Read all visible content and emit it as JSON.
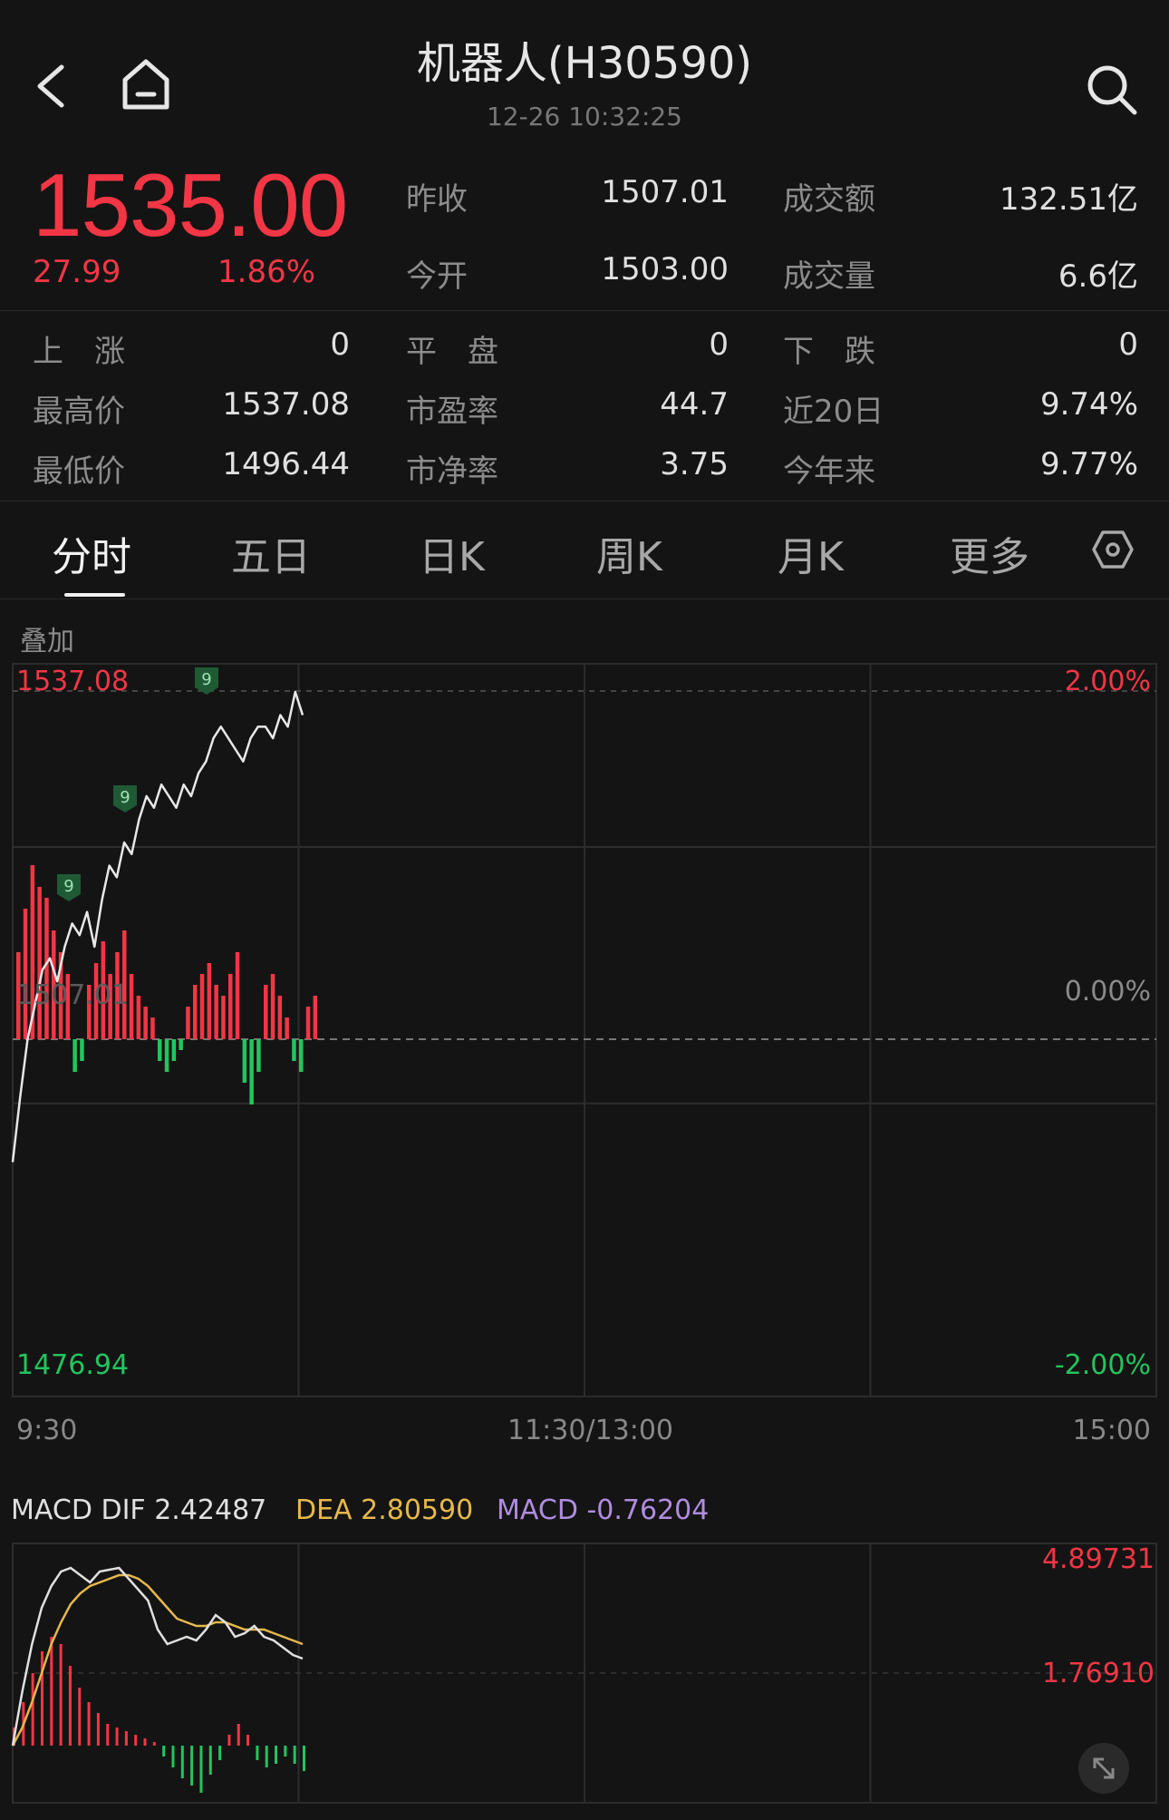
{
  "header": {
    "title": "机器人(H30590)",
    "datetime": "12-26 10:32:25"
  },
  "quote": {
    "price": "1535.00",
    "change": "27.99",
    "change_pct": "1.86%",
    "color_up": "#f23645",
    "color_down": "#23c45e"
  },
  "stats": [
    {
      "label": "昨收",
      "value": "1507.01"
    },
    {
      "label": "成交额",
      "value": "132.51亿"
    },
    {
      "label": "今开",
      "value": "1503.00"
    },
    {
      "label": "成交量",
      "value": "6.6亿"
    },
    {
      "label": "上　涨",
      "value": "0"
    },
    {
      "label": "平　盘",
      "value": "0"
    },
    {
      "label": "下　跌",
      "value": "0"
    },
    {
      "label": "最高价",
      "value": "1537.08"
    },
    {
      "label": "市盈率",
      "value": "44.7"
    },
    {
      "label": "近20日",
      "value": "9.74%"
    },
    {
      "label": "最低价",
      "value": "1496.44"
    },
    {
      "label": "市净率",
      "value": "3.75"
    },
    {
      "label": "今年来",
      "value": "9.77%"
    }
  ],
  "tabs": [
    "分时",
    "五日",
    "日K",
    "周K",
    "月K",
    "更多"
  ],
  "active_tab": "分时",
  "overlay_label": "叠加",
  "intraday": {
    "high_label": "1537.08",
    "low_label": "1476.94",
    "prev_close_label": "1507.01",
    "pct_top": "2.00%",
    "pct_mid": "0.00%",
    "pct_bottom": "-2.00%",
    "times": [
      "9:30",
      "11:30/13:00",
      "15:00"
    ],
    "marker_label": "9",
    "price_series": [
      1496.4,
      1502,
      1507,
      1510,
      1513,
      1514,
      1512,
      1515,
      1517,
      1516,
      1518,
      1515,
      1519,
      1522,
      1521,
      1524,
      1523,
      1526,
      1528,
      1527,
      1529,
      1528,
      1527,
      1529,
      1528,
      1530,
      1531,
      1533,
      1534,
      1533,
      1532,
      1531,
      1533,
      1534,
      1534,
      1533,
      1535,
      1534,
      1537,
      1535
    ],
    "volume_bars": [
      8,
      12,
      16,
      14,
      13,
      10,
      8,
      6,
      -3,
      -2,
      5,
      7,
      9,
      6,
      8,
      10,
      6,
      4,
      3,
      2,
      -2,
      -3,
      -2,
      -1,
      3,
      5,
      6,
      7,
      5,
      4,
      6,
      8,
      -4,
      -6,
      -3,
      5,
      6,
      4,
      2,
      -2,
      -3,
      3,
      4
    ],
    "icons": {
      "settings": "hexagon-settings-icon",
      "back": "chevron-left-icon",
      "home": "home-icon",
      "search": "search-icon",
      "expand": "expand-icon"
    }
  },
  "macd": {
    "legend_dif": "MACD DIF 2.42487",
    "legend_dea": "DEA 2.80590",
    "legend_macd": "MACD -0.76204",
    "dif_color": "#e0e0e0",
    "dea_color": "#e6b84c",
    "macd_color": "#b08ce0",
    "label_top": "4.89731",
    "label_mid": "1.76910",
    "dif": [
      0,
      1.5,
      2.8,
      3.8,
      4.4,
      4.8,
      4.9,
      4.7,
      4.5,
      4.8,
      4.85,
      4.9,
      4.6,
      4.3,
      4.0,
      3.2,
      2.8,
      2.9,
      3.0,
      2.9,
      3.2,
      3.6,
      3.4,
      3.0,
      3.1,
      3.3,
      3.0,
      2.9,
      2.7,
      2.5,
      2.4
    ],
    "dea": [
      0,
      0.5,
      1.2,
      2.0,
      2.8,
      3.4,
      3.9,
      4.2,
      4.4,
      4.5,
      4.6,
      4.7,
      4.7,
      4.6,
      4.4,
      4.1,
      3.8,
      3.5,
      3.4,
      3.3,
      3.3,
      3.4,
      3.4,
      3.3,
      3.2,
      3.2,
      3.2,
      3.1,
      3.0,
      2.9,
      2.8
    ],
    "hist": [
      0.5,
      1.2,
      2.0,
      2.6,
      3.0,
      2.8,
      2.2,
      1.6,
      1.2,
      0.9,
      0.6,
      0.5,
      0.4,
      0.3,
      0.2,
      0.1,
      -0.3,
      -0.6,
      -0.9,
      -1.1,
      -1.3,
      -0.8,
      -0.4,
      0.3,
      0.6,
      0.3,
      -0.4,
      -0.6,
      -0.5,
      -0.3,
      -0.5,
      -0.7
    ]
  }
}
